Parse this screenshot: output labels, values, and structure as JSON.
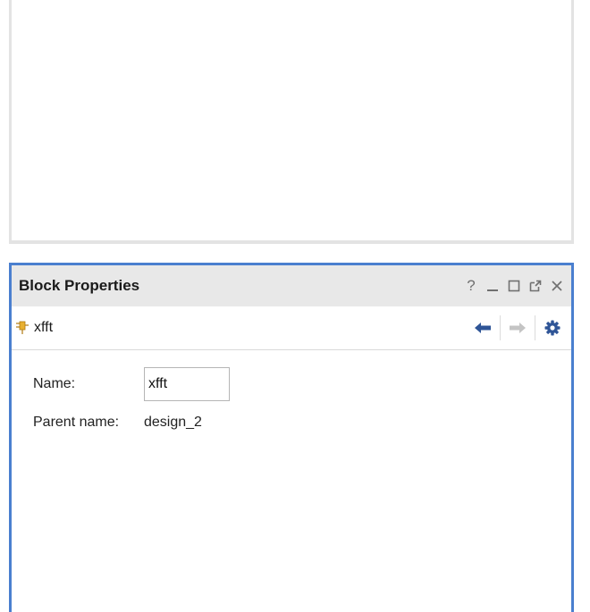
{
  "panel": {
    "title": "Block Properties",
    "window_controls": {
      "help": "?",
      "minimize": "_",
      "maximize": "□",
      "float": "⧉",
      "close": "×"
    },
    "icons": [
      "block-icon",
      "back-arrow-icon",
      "forward-arrow-icon",
      "gear-icon"
    ],
    "colors": {
      "accent_border": "#4a7fcf",
      "icon_blue": "#2f5597",
      "icon_disabled": "#c4c4c4",
      "block_icon": "#e8b030"
    }
  },
  "toolbar": {
    "object_name": "xfft"
  },
  "properties": {
    "name_label": "Name:",
    "name_value": "xfft",
    "parent_label": "Parent name:",
    "parent_value": "design_2"
  }
}
